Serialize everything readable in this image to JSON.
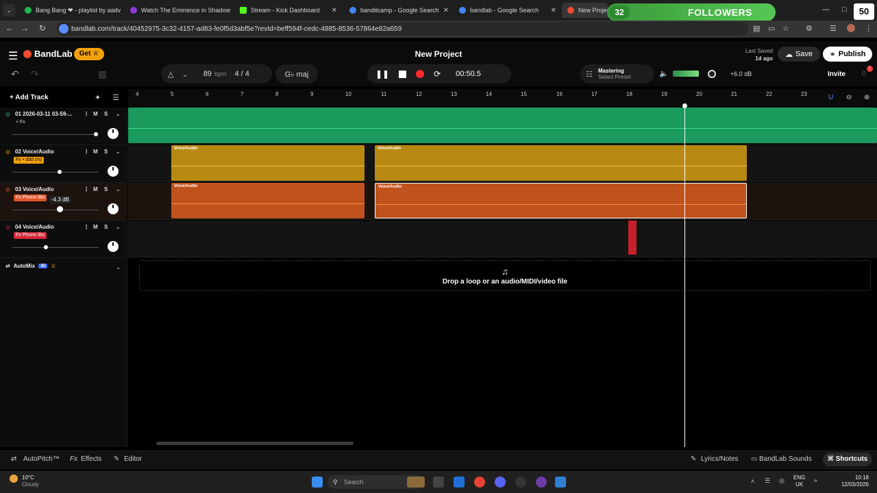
{
  "browser": {
    "tabs": [
      {
        "label": "Bang Bang ❤ - playlist by aadv",
        "color": "#1db954"
      },
      {
        "label": "Watch The Eminence in Shadow",
        "color": "#8a3cd7"
      },
      {
        "label": "Stream - Kick Dashboard",
        "color": "#53fc18"
      },
      {
        "label": "banditcamp - Google Search",
        "color": "#4285f4"
      },
      {
        "label": "bandlab - Google Search",
        "color": "#4285f4"
      },
      {
        "label": "New Project",
        "color": "#f04a32"
      }
    ],
    "url": "bandlab.com/track/40452975-3c32-4157-ad83-fe0f5d3abf5e?revId=beff594f-cedc-4885-8536-57864e82a659"
  },
  "overlay": {
    "followers_count": "32",
    "followers_label": "FOLLOWERS",
    "goal": "50"
  },
  "app": {
    "logo": "BandLab",
    "get_label": "Get",
    "title": "New Project",
    "last_saved_label": "Last Saved",
    "last_saved_value": "1d ago",
    "save_label": "Save",
    "publish_label": "Publish",
    "invite_label": "Invite",
    "notif_count": "1"
  },
  "toolbar": {
    "bpm": "89",
    "bpm_unit": "bpm",
    "time_sig": "4 / 4",
    "key": "G♭ maj",
    "time": "00:50.5",
    "mastering_title": "Mastering",
    "mastering_preset": "Select Preset",
    "master_db": "+6.0 dB"
  },
  "tracks_panel": {
    "add_track_label": "Add Track",
    "tracks": [
      {
        "name": "01  2026-03-11 03-59-...",
        "fx": "+ Fx",
        "fx_bg": "transparent",
        "fx_color": "#ddd",
        "accent": "#2fc46a"
      },
      {
        "name": "02  Voice/Audio",
        "fx": "Fx • ddd (m)",
        "fx_bg": "#f2a10c",
        "fx_color": "#000",
        "accent": "#f2a10c"
      },
      {
        "name": "03  Voice/Audio",
        "fx": "Fx  Phone libs",
        "fx_bg": "#e0552a",
        "fx_color": "#fff",
        "accent": "#e0552a"
      },
      {
        "name": "04  Voice/Audio",
        "fx": "Fx  Phone libs",
        "fx_bg": "#d0283a",
        "fx_color": "#fff",
        "accent": "#d0283a"
      }
    ],
    "volume_tooltip": "-4.3 dB",
    "automix_label": "AutoMix",
    "automix_badge": "AI"
  },
  "timeline": {
    "bars": [
      "4",
      "5",
      "6",
      "7",
      "8",
      "9",
      "10",
      "11",
      "12",
      "13",
      "14",
      "15",
      "16",
      "17",
      "18",
      "19",
      "20",
      "21",
      "22",
      "23"
    ],
    "region_label": "Voice/Audio",
    "drop_text": "Drop a loop or an audio/MIDI/video file"
  },
  "bottom": {
    "autopitch": "AutoPitch™",
    "effects": "Effects",
    "editor": "Editor",
    "lyrics": "Lyrics/Notes",
    "sounds": "BandLab Sounds",
    "shortcuts": "Shortcuts"
  },
  "taskbar": {
    "temp": "10°C",
    "weather": "Cloudy",
    "search_placeholder": "Search",
    "lang_top": "ENG",
    "lang_bottom": "UK",
    "time": "10:18",
    "date": "12/03/2026"
  }
}
